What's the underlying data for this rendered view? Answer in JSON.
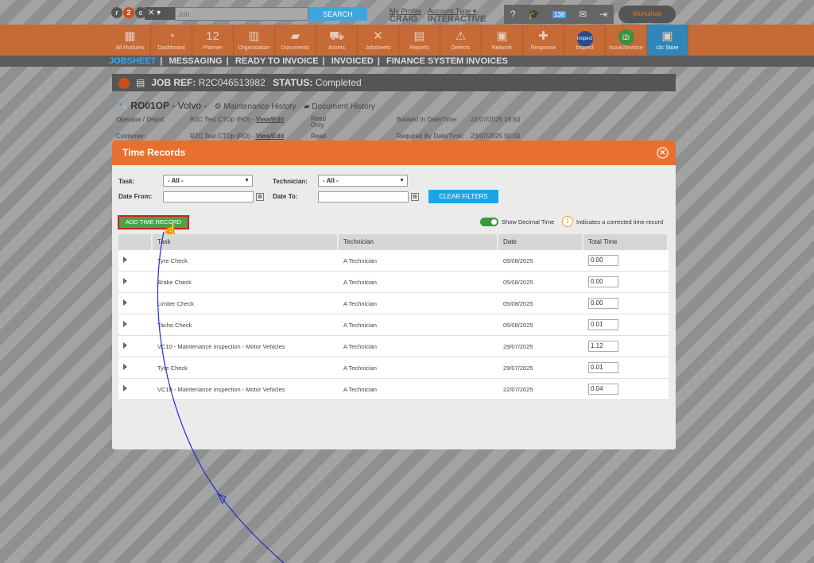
{
  "topbar": {
    "logo": {
      "r": "r",
      "two": "2",
      "c": "c"
    },
    "search_placeholder": "Job",
    "search_button": "SEARCH",
    "profile_link": "My Profile",
    "profile_name": "CRAIG",
    "account_link": "Account Type",
    "account_name": "INTERACTIVE",
    "badge": "136",
    "workshop": "Workshop"
  },
  "modules": [
    {
      "label": "All Modules",
      "icon": "grid-icon",
      "glyph": "▦"
    },
    {
      "label": "Dashboard",
      "icon": "gauge-icon",
      "glyph": "◔"
    },
    {
      "label": "Planner",
      "icon": "calendar-icon",
      "glyph": "12"
    },
    {
      "label": "Organisation",
      "icon": "building-icon",
      "glyph": "▥"
    },
    {
      "label": "Documents",
      "icon": "folder-icon",
      "glyph": "▰"
    },
    {
      "label": "Assets",
      "icon": "truck-icon",
      "glyph": "⛟"
    },
    {
      "label": "Jobsheets",
      "icon": "tools-icon",
      "glyph": "✕"
    },
    {
      "label": "Reports",
      "icon": "report-icon",
      "glyph": "▤"
    },
    {
      "label": "Defects",
      "icon": "warning-icon",
      "glyph": "⚠"
    },
    {
      "label": "Network",
      "icon": "network-icon",
      "glyph": "▣"
    },
    {
      "label": "Response",
      "icon": "response-icon",
      "glyph": "✚"
    },
    {
      "label": "Inspect",
      "icon": "inspect-icon",
      "glyph": "Inspect"
    },
    {
      "label": "Issue2Invoice",
      "icon": "i2i-icon",
      "glyph": "i2i"
    },
    {
      "label": "r2c Store",
      "icon": "store-icon",
      "glyph": "▣"
    }
  ],
  "subnav": [
    "JOBSHEET",
    "MESSAGING",
    "READY TO INVOICE",
    "INVOICED",
    "FINANCE SYSTEM INVOICES"
  ],
  "job": {
    "ref_label": "JOB REF:",
    "ref": "R2C046513982",
    "status_label": "STATUS:",
    "status": "Completed"
  },
  "vehicle": {
    "reg": "RO01OP",
    "make": "Volvo",
    "maint": "Maintenance History",
    "docs": "Document History",
    "operator_label": "Operator / Depot:",
    "operator": "R2C Test CTOp (RO)",
    "view_edit": "View/Edit",
    "read": "Read",
    "only": "Only",
    "booked_label": "Booked In Date/Time:",
    "booked": "22/07/2025 16:50",
    "customer_label": "Customer:",
    "customer": "R2C Test CTOp (RO)",
    "required_label": "Required By Date/Time:",
    "required": "23/07/2025 00:00"
  },
  "modal": {
    "title": "Time Records",
    "task_label": "Task:",
    "task_value": "- All -",
    "technician_label": "Technician:",
    "technician_value": "- All -",
    "date_from_label": "Date From:",
    "date_to_label": "Date To:",
    "clear_filters": "CLEAR FILTERS",
    "add_record": "ADD TIME RECORD",
    "decimal_label": "Show Decimal Time",
    "corrected_label": "Indicates a corrected time record",
    "columns": [
      "Task",
      "Technician",
      "Date",
      "Total Time"
    ],
    "rows": [
      {
        "task": "Tyre Check",
        "technician": "A Technician",
        "date": "05/08/2025",
        "total": "0.00"
      },
      {
        "task": "Brake Check",
        "technician": "A Technician",
        "date": "05/08/2025",
        "total": "0.00"
      },
      {
        "task": "Limiter Check",
        "technician": "A Technician",
        "date": "05/08/2025",
        "total": "0.00"
      },
      {
        "task": "Tacho Check",
        "technician": "A Technician",
        "date": "05/08/2025",
        "total": "0.01"
      },
      {
        "task": "VC10 - Maintenance Inspection - Motor Vehicles",
        "technician": "A Technician",
        "date": "29/07/2025",
        "total": "1.12"
      },
      {
        "task": "Tyre Check",
        "technician": "A Technician",
        "date": "29/07/2025",
        "total": "0.01"
      },
      {
        "task": "VC10 - Maintenance Inspection - Motor Vehicles",
        "technician": "A Technician",
        "date": "22/07/2025",
        "total": "0.04"
      }
    ]
  },
  "colors": {
    "accent": "#e8702f",
    "link_blue": "#1aa6e5",
    "add_green": "#4aa24a",
    "highlight_red": "#d11e1e"
  }
}
